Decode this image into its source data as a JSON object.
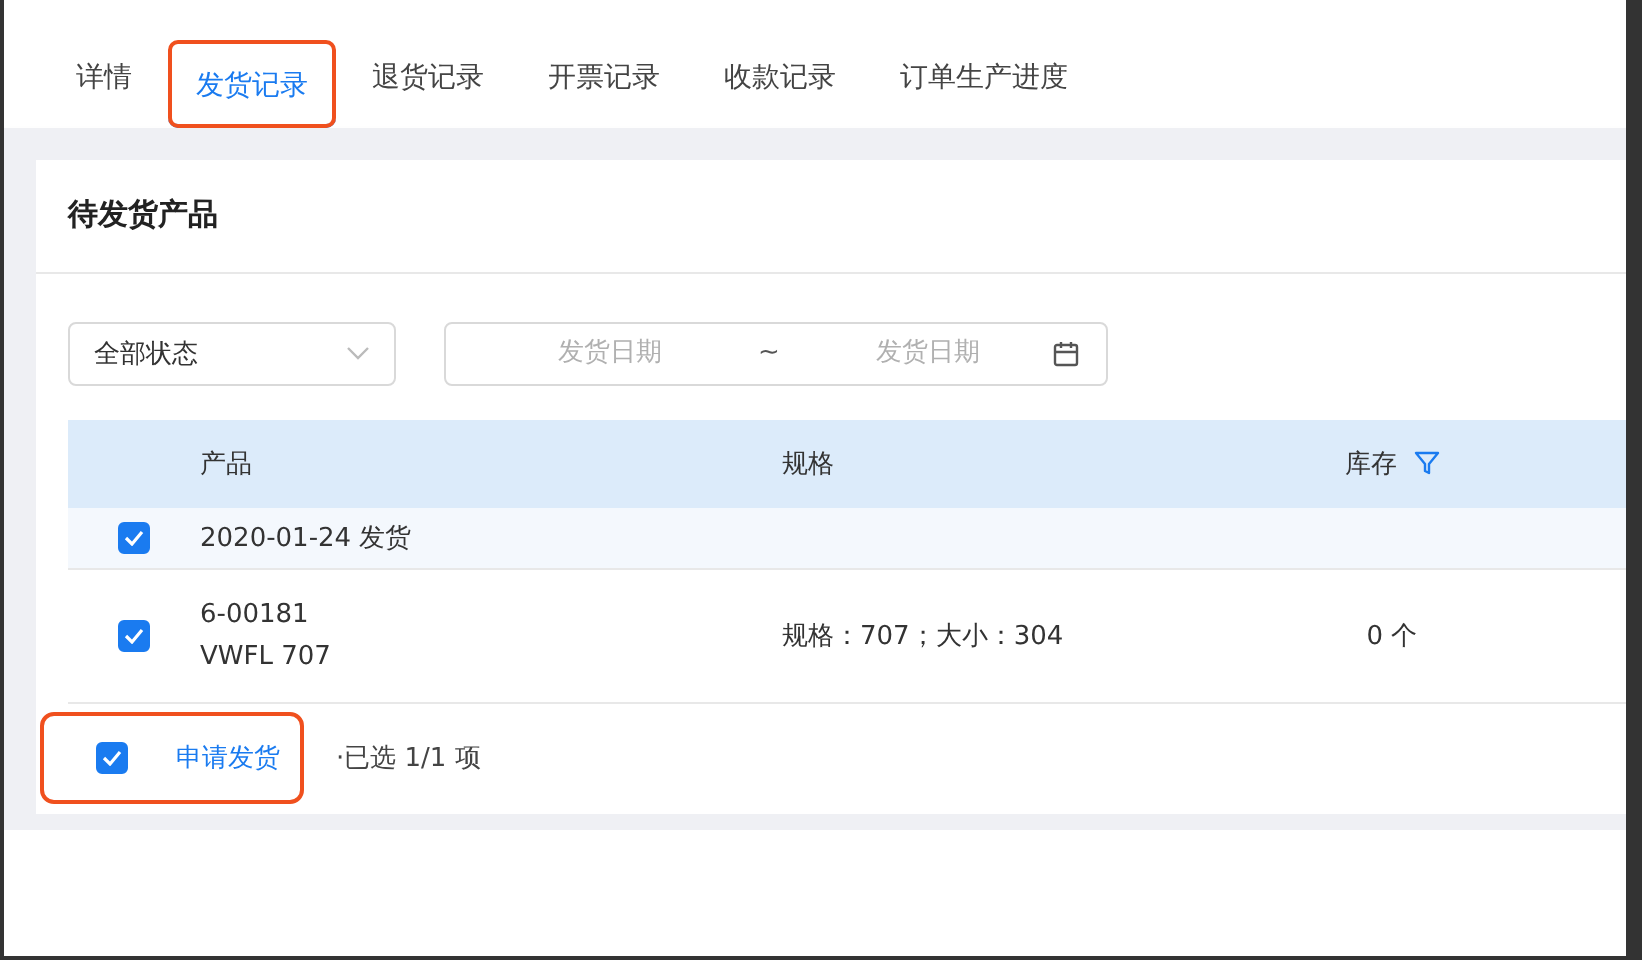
{
  "tabs": [
    {
      "label": "详情",
      "selected": false,
      "highlighted": false
    },
    {
      "label": "发货记录",
      "selected": true,
      "highlighted": true
    },
    {
      "label": "退货记录",
      "selected": false,
      "highlighted": false
    },
    {
      "label": "开票记录",
      "selected": false,
      "highlighted": false
    },
    {
      "label": "收款记录",
      "selected": false,
      "highlighted": false
    },
    {
      "label": "订单生产进度",
      "selected": false,
      "highlighted": false
    }
  ],
  "card": {
    "title": "待发货产品",
    "filters": {
      "status": "全部状态",
      "date_start": {
        "placeholder": "发货日期"
      },
      "separator": "~",
      "date_end": {
        "placeholder": "发货日期"
      }
    },
    "table": {
      "columns": [
        "产品",
        "规格",
        "库存"
      ],
      "groups": [
        {
          "label": "2020-01-24 发货",
          "checked": true,
          "rows": [
            {
              "checked": true,
              "code": "6-00181",
              "name": "VWFL 707",
              "spec": "规格：707；大小：304",
              "stock": "0 个"
            }
          ]
        }
      ]
    },
    "footer": {
      "checked": true,
      "button": "申请发货",
      "summary": "·已选 1/1 项",
      "highlighted": true
    }
  }
}
